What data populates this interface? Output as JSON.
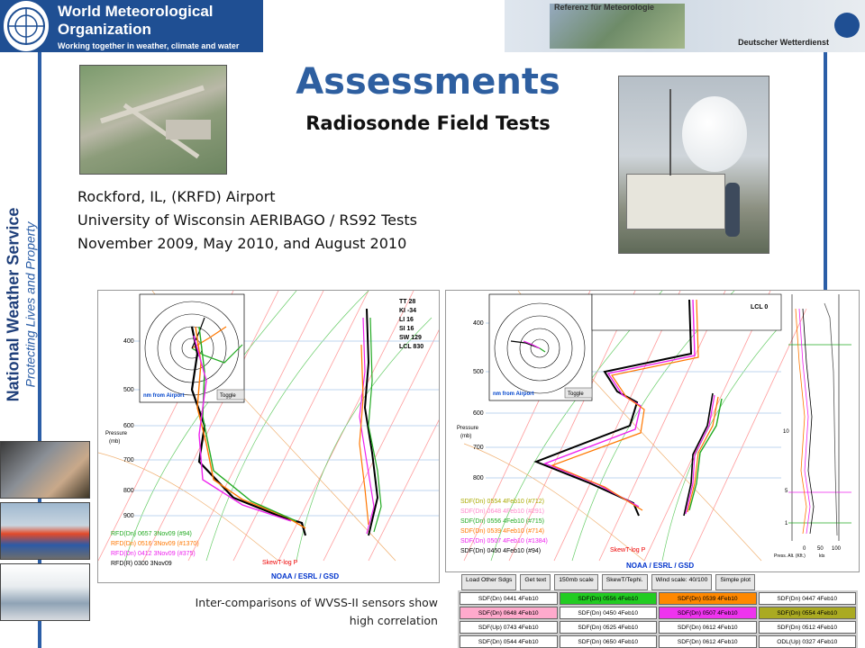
{
  "header": {
    "wmo_title": "World Meteorological Organization",
    "wmo_subtitle": "Working together in weather, climate and water",
    "dwd_ref": "Referenz für Meteorologie",
    "dwd_name": "Deutscher Wetterdienst"
  },
  "sidebar": {
    "org": "National Weather Service",
    "tagline": "Protecting Lives and Property"
  },
  "slide": {
    "title": "Assessments",
    "subtitle": "Radiosonde Field Tests",
    "lines": [
      "Rockford, IL, (KRFD) Airport",
      "University of Wisconsin AERIBAGO / RS92 Tests",
      "November 2009, May 2010, and August 2010"
    ],
    "caption_line1": "Inter-comparisons of WVSS-II sensors show",
    "caption_line2": "high correlation"
  },
  "left_plot": {
    "hodo_label": "nm from Airport",
    "toggle": "Toggle",
    "pressure_label": "Pressure",
    "pressure_unit": "(mb)",
    "indices": [
      "TT 28",
      "KI -34",
      "LI 16",
      "SI 16",
      "SW 129",
      "LCL 830"
    ],
    "pressure_ticks": [
      "400",
      "500",
      "600",
      "700",
      "800",
      "900"
    ],
    "legend": [
      {
        "text": "RFD(Dn) 0657 3Nov09 (#94)",
        "color": "#22aa22"
      },
      {
        "text": "RFD(Dn) 0516 3Nov09 (#1370)",
        "color": "#ff7700"
      },
      {
        "text": "RFD(Dn) 0412 3Nov09 (#375)",
        "color": "#ee22ee"
      },
      {
        "text": "RFD(R) 0300 3Nov09",
        "color": "#000000"
      }
    ],
    "skewt_label": "SkewT-log P",
    "brand": "NOAA / ESRL / GSD"
  },
  "right_plot": {
    "hodo_label": "nm from Airport",
    "toggle": "Toggle",
    "pressure_label": "Pressure",
    "pressure_unit": "(mb)",
    "lcl": "LCL 0",
    "pressure_ticks": [
      "400",
      "500",
      "600",
      "700",
      "800"
    ],
    "legend": [
      {
        "text": "SDF(Dn) 0554 4Feb10 (#712)",
        "color": "#aaaa00"
      },
      {
        "text": "SDF(Dn) 0648 4Feb10 (#291)",
        "color": "#ff88cc"
      },
      {
        "text": "SDF(Dn) 0556 4Feb10 (#715)",
        "color": "#22aa22"
      },
      {
        "text": "SDF(Dn) 0539 4Feb10 (#714)",
        "color": "#ff7700"
      },
      {
        "text": "SDF(Dn) 0507 4Feb10 (#1384)",
        "color": "#ee22ee"
      },
      {
        "text": "SDF(Dn) 0450 4Feb10 (#94)",
        "color": "#000000"
      }
    ],
    "skewt_label": "SkewT-log P",
    "brand": "NOAA / ESRL / GSD",
    "alt_label": "Press. Alt. (Kft.)",
    "kts_label": "kts",
    "kts_ticks": [
      "0",
      "50",
      "100"
    ],
    "alt_ticks": [
      "10",
      "5",
      "1"
    ]
  },
  "toolbar": {
    "buttons": [
      "Load Other Sdgs",
      "Get text",
      "150mb scale",
      "SkewT/Tephi.",
      "Wind scale: 40/100",
      "Simple plot"
    ]
  },
  "sounding_table": [
    {
      "label": "SDF(Dn) 0441 4Feb10",
      "bg": "#ffffff"
    },
    {
      "label": "SDF(Dn) 0556 4Feb10",
      "bg": "#22cc22"
    },
    {
      "label": "SDF(Dn) 0539 4Feb10",
      "bg": "#ff8800"
    },
    {
      "label": "SDF(Dn) 0447 4Feb10",
      "bg": "#ffffff"
    },
    {
      "label": "SDF(Dn) 0648 4Feb10",
      "bg": "#ffaacc"
    },
    {
      "label": "SDF(Dn) 0450 4Feb10",
      "bg": "#ffffff"
    },
    {
      "label": "SDF(Dn) 0507 4Feb10",
      "bg": "#ee33ee"
    },
    {
      "label": "SDF(Dn) 0554 4Feb10",
      "bg": "#aaaa22"
    },
    {
      "label": "SDF(Up) 0743 4Feb10",
      "bg": "#ffffff"
    },
    {
      "label": "SDF(Dn) 0525 4Feb10",
      "bg": "#ffffff"
    },
    {
      "label": "SDF(Dn) 0612 4Feb10",
      "bg": "#ffffff"
    },
    {
      "label": "SDF(Dn) 0512 4Feb10",
      "bg": "#ffffff"
    },
    {
      "label": "SDF(Dn) 0544 4Feb10",
      "bg": "#ffffff"
    },
    {
      "label": "SDF(Dn) 0650 4Feb10",
      "bg": "#ffffff"
    },
    {
      "label": "SDF(Dn) 0612 4Feb10",
      "bg": "#ffffff"
    },
    {
      "label": "ODL(Up) 0327 4Feb10",
      "bg": "#ffffff"
    }
  ],
  "colors": {
    "accent": "#2e5fa0",
    "wmo_blue": "#1f4f93"
  }
}
